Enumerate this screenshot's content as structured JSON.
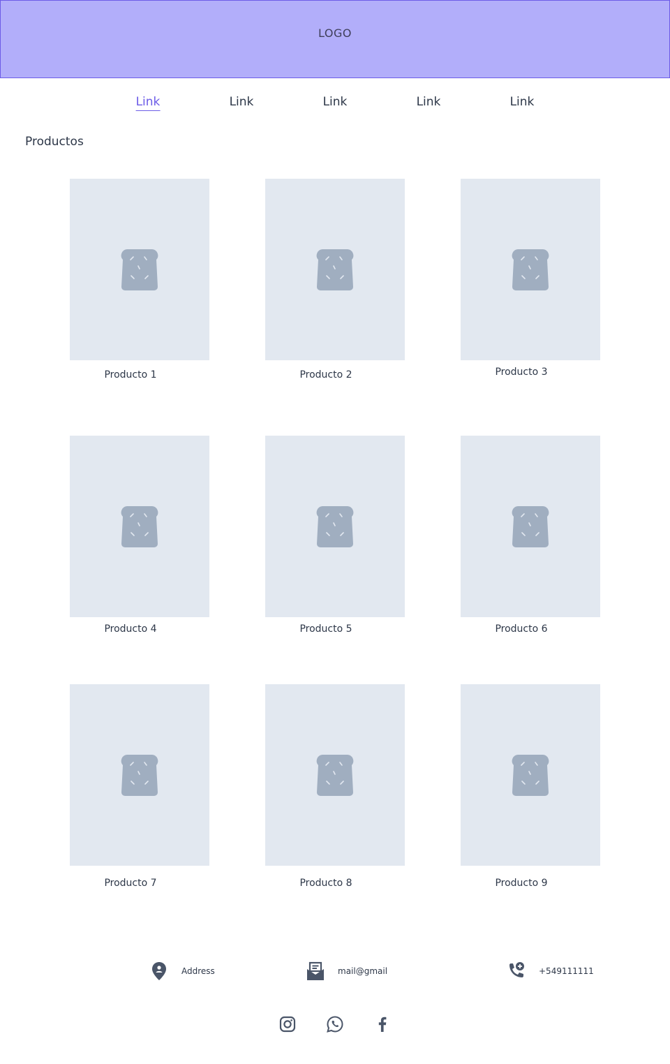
{
  "header": {
    "logo": "LOGO"
  },
  "nav": {
    "links": [
      "Link",
      "Link",
      "Link",
      "Link",
      "Link"
    ],
    "active_index": 0
  },
  "section": {
    "title": "Productos"
  },
  "products": [
    "Producto 1",
    "Producto 2",
    "Producto 3",
    "Producto 4",
    "Producto 5",
    "Producto 6",
    "Producto 7",
    "Producto 8",
    "Producto 9"
  ],
  "footer": {
    "address": "Address",
    "email": "mail@gmail",
    "phone": "+549111111",
    "social_icons": [
      "instagram-icon",
      "whatsapp-icon",
      "facebook-icon"
    ]
  },
  "colors": {
    "header_bg": "#b2aefa",
    "accent": "#6c5ce7",
    "placeholder_bg": "#e2e8f0",
    "placeholder_icon": "#a0aec0",
    "text": "#2d3748"
  },
  "icons": {
    "product_placeholder": "toast-bread-icon"
  }
}
